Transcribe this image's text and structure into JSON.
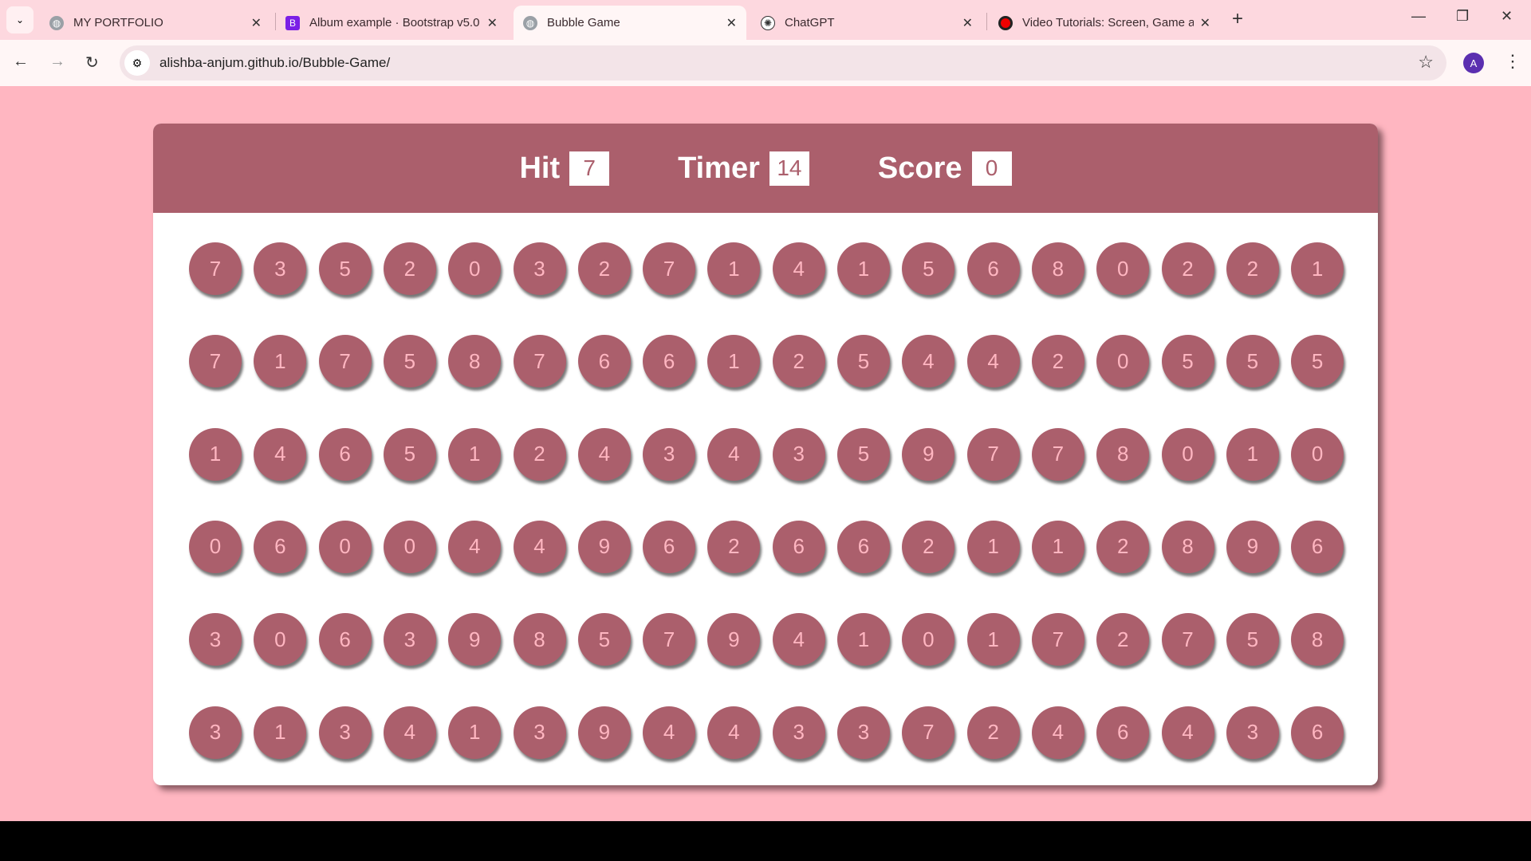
{
  "browser": {
    "tabs": [
      {
        "title": "MY PORTFOLIO",
        "icon": "globe-icon",
        "active": false
      },
      {
        "title": "Album example · Bootstrap v5.0",
        "icon": "bootstrap-icon",
        "icon_text": "B",
        "active": false
      },
      {
        "title": "Bubble Game",
        "icon": "globe-icon",
        "active": true
      },
      {
        "title": "ChatGPT",
        "icon": "chatgpt-icon",
        "active": false
      },
      {
        "title": "Video Tutorials: Screen, Game a",
        "icon": "record-icon",
        "active": false
      }
    ],
    "url": "alishba-anjum.github.io/Bubble-Game/",
    "profile_initial": "A"
  },
  "game": {
    "hit_label": "Hit",
    "hit_value": "7",
    "timer_label": "Timer",
    "timer_value": "14",
    "score_label": "Score",
    "score_value": "0",
    "bubbles": [
      [
        7,
        3,
        5,
        2,
        0,
        3,
        2,
        7,
        1,
        4,
        1,
        5,
        6,
        8,
        0,
        2,
        2,
        1
      ],
      [
        7,
        1,
        7,
        5,
        8,
        7,
        6,
        6,
        1,
        2,
        5,
        4,
        4,
        2,
        0,
        5,
        5,
        5
      ],
      [
        1,
        4,
        6,
        5,
        1,
        2,
        4,
        3,
        4,
        3,
        5,
        9,
        7,
        7,
        8,
        0,
        1,
        0
      ],
      [
        0,
        6,
        0,
        0,
        4,
        4,
        9,
        6,
        2,
        6,
        6,
        2,
        1,
        1,
        2,
        8,
        9,
        6
      ],
      [
        3,
        0,
        6,
        3,
        9,
        8,
        5,
        7,
        9,
        4,
        1,
        0,
        1,
        7,
        2,
        7,
        5,
        8
      ],
      [
        3,
        1,
        3,
        4,
        1,
        3,
        9,
        4,
        4,
        3,
        3,
        7,
        2,
        4,
        6,
        4,
        3,
        6
      ]
    ]
  },
  "colors": {
    "page_bg": "#ffb6c1",
    "accent": "#ab5f6c",
    "bubble_text": "#ffb6c1"
  }
}
